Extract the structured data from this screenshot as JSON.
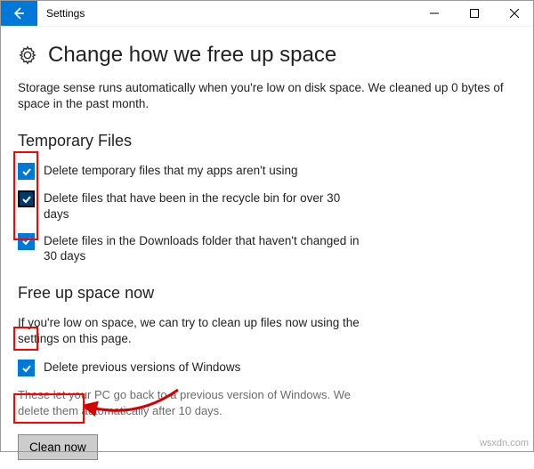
{
  "titlebar": {
    "app_name": "Settings"
  },
  "header": {
    "title": "Change how we free up space"
  },
  "intro": "Storage sense runs automatically when you're low on disk space. We cleaned up 0 bytes of space in the past month.",
  "section1": {
    "title": "Temporary Files",
    "opt1": "Delete temporary files that my apps aren't using",
    "opt2": "Delete files that have been in the recycle bin for over 30 days",
    "opt3": "Delete files in the Downloads folder that haven't changed in 30 days"
  },
  "section2": {
    "title": "Free up space now",
    "body": "If you're low on space, we can try to clean up files now using the settings on this page.",
    "opt1": "Delete previous versions of Windows",
    "note": "These let your PC go back to a previous version of Windows. We delete them automatically after 10 days.",
    "button": "Clean now"
  },
  "watermark": "wsxdn.com"
}
